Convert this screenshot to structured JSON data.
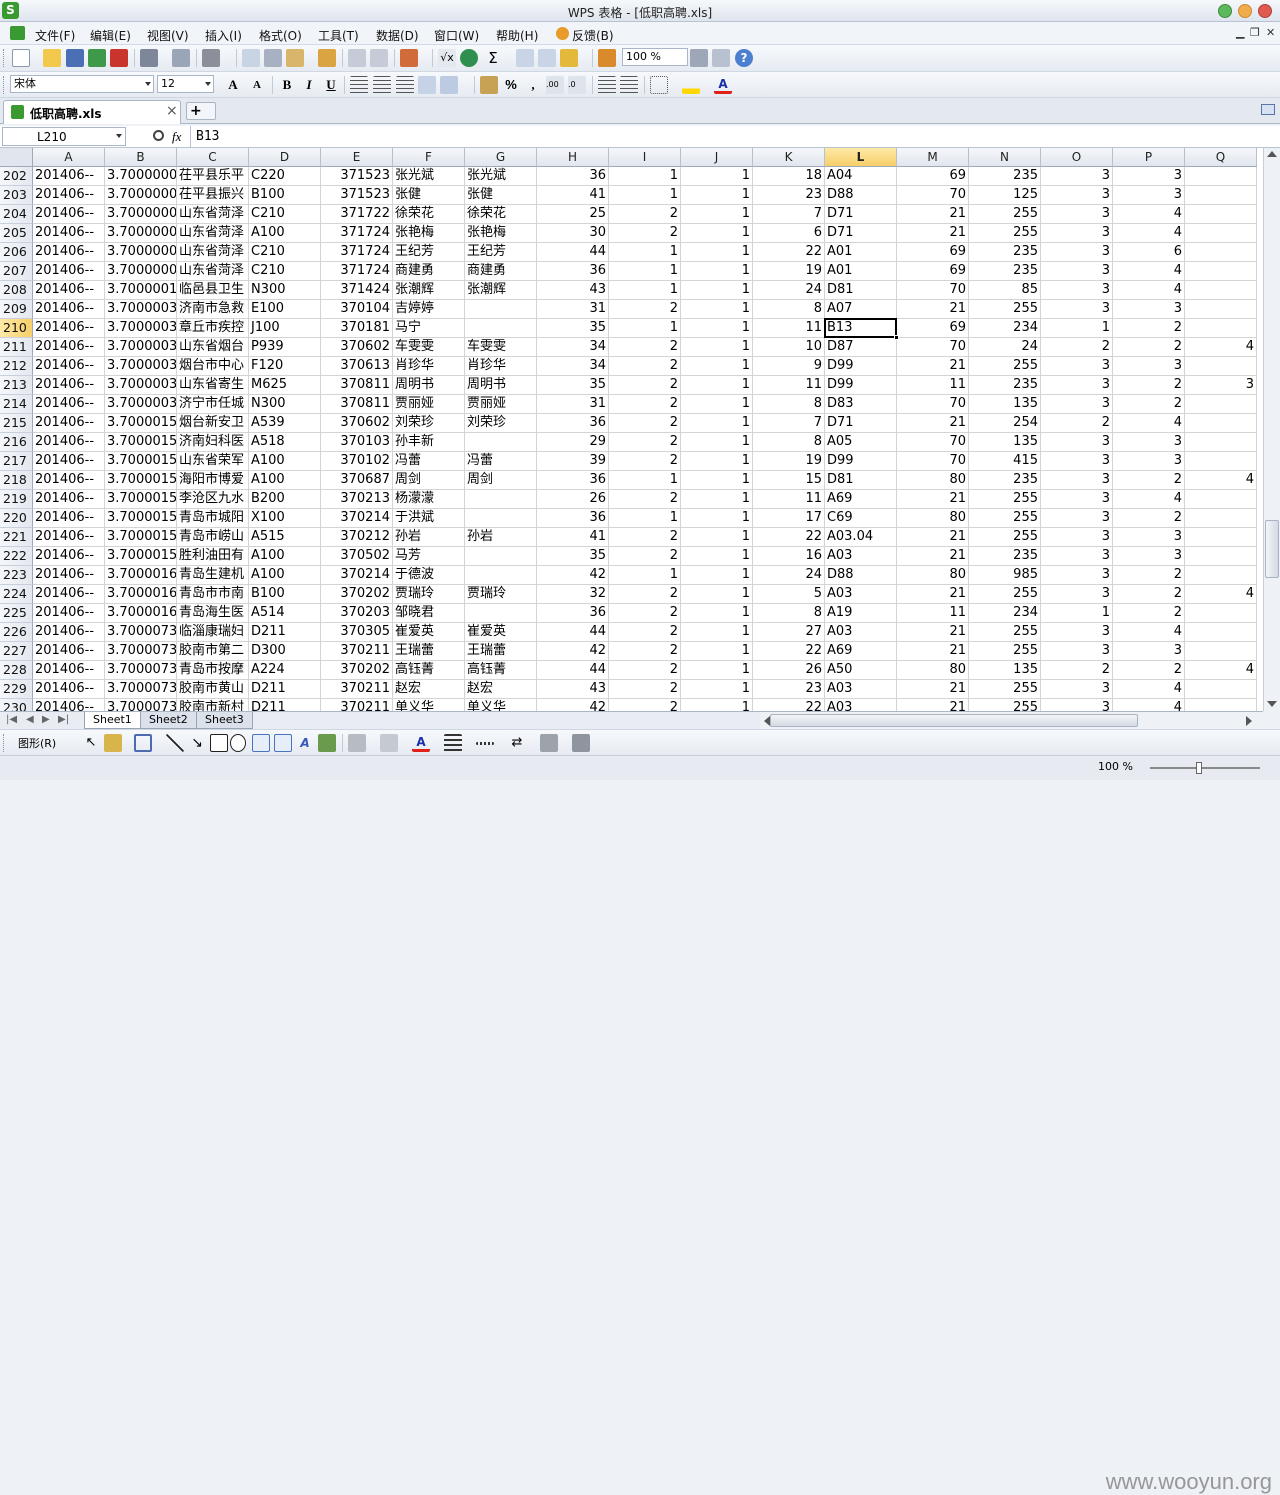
{
  "window": {
    "title": "WPS 表格 - [低职高聘.xls]"
  },
  "menu": [
    "文件(F)",
    "编辑(E)",
    "视图(V)",
    "插入(I)",
    "格式(O)",
    "工具(T)",
    "数据(D)",
    "窗口(W)",
    "帮助(H)",
    "反馈(B)"
  ],
  "toolbar": {
    "zoom": "100 %",
    "font_name": "宋体",
    "font_size": "12",
    "bold": "B",
    "italic": "I",
    "underline": "U",
    "percent": "%"
  },
  "doc_tab": {
    "label": "低职高聘.xls",
    "close": "×",
    "add": "+"
  },
  "formula_bar": {
    "name_box": "L210",
    "fx": "fx",
    "value": "B13"
  },
  "columns": [
    "A",
    "B",
    "C",
    "D",
    "E",
    "F",
    "G",
    "H",
    "I",
    "J",
    "K",
    "L",
    "M",
    "N",
    "O",
    "P",
    "Q"
  ],
  "active_column": "L",
  "active_row": "210",
  "rows": [
    {
      "n": "202",
      "A": "201406--",
      "B": "3.7000000",
      "C": "茌平县乐平",
      "D": "C220",
      "E": "371523",
      "F": "张光斌",
      "G": "张光斌",
      "H": "36",
      "I": "1",
      "J": "1",
      "K": "18",
      "L": "A04",
      "M": "69",
      "N": "235",
      "O": "3",
      "P": "3",
      "Q": ""
    },
    {
      "n": "203",
      "A": "201406--",
      "B": "3.7000000",
      "C": "茌平县振兴",
      "D": "B100",
      "E": "371523",
      "F": "张健",
      "G": "张健",
      "H": "41",
      "I": "1",
      "J": "1",
      "K": "23",
      "L": "D88",
      "M": "70",
      "N": "125",
      "O": "3",
      "P": "3",
      "Q": ""
    },
    {
      "n": "204",
      "A": "201406--",
      "B": "3.7000000",
      "C": "山东省菏泽",
      "D": "C210",
      "E": "371722",
      "F": "徐荣花",
      "G": "徐荣花",
      "H": "25",
      "I": "2",
      "J": "1",
      "K": "7",
      "L": "D71",
      "M": "21",
      "N": "255",
      "O": "3",
      "P": "4",
      "Q": ""
    },
    {
      "n": "205",
      "A": "201406--",
      "B": "3.7000000",
      "C": "山东省菏泽",
      "D": "A100",
      "E": "371724",
      "F": "张艳梅",
      "G": "张艳梅",
      "H": "30",
      "I": "2",
      "J": "1",
      "K": "6",
      "L": "D71",
      "M": "21",
      "N": "255",
      "O": "3",
      "P": "4",
      "Q": ""
    },
    {
      "n": "206",
      "A": "201406--",
      "B": "3.7000000",
      "C": "山东省菏泽",
      "D": "C210",
      "E": "371724",
      "F": "王纪芳",
      "G": "王纪芳",
      "H": "44",
      "I": "1",
      "J": "1",
      "K": "22",
      "L": "A01",
      "M": "69",
      "N": "235",
      "O": "3",
      "P": "6",
      "Q": ""
    },
    {
      "n": "207",
      "A": "201406--",
      "B": "3.7000000",
      "C": "山东省菏泽",
      "D": "C210",
      "E": "371724",
      "F": "商建勇",
      "G": "商建勇",
      "H": "36",
      "I": "1",
      "J": "1",
      "K": "19",
      "L": "A01",
      "M": "69",
      "N": "235",
      "O": "3",
      "P": "4",
      "Q": ""
    },
    {
      "n": "208",
      "A": "201406--",
      "B": "3.7000001",
      "C": "临邑县卫生",
      "D": "N300",
      "E": "371424",
      "F": "张潮辉",
      "G": "张潮辉",
      "H": "43",
      "I": "1",
      "J": "1",
      "K": "24",
      "L": "D81",
      "M": "70",
      "N": "85",
      "O": "3",
      "P": "4",
      "Q": ""
    },
    {
      "n": "209",
      "A": "201406--",
      "B": "3.7000003",
      "C": "济南市急救",
      "D": "E100",
      "E": "370104",
      "F": "吉婷婷",
      "G": "",
      "H": "31",
      "I": "2",
      "J": "1",
      "K": "8",
      "L": "A07",
      "M": "21",
      "N": "255",
      "O": "3",
      "P": "3",
      "Q": ""
    },
    {
      "n": "210",
      "A": "201406--",
      "B": "3.7000003",
      "C": "章丘市疾控",
      "D": "J100",
      "E": "370181",
      "F": "马宁",
      "G": "",
      "H": "35",
      "I": "1",
      "J": "1",
      "K": "11",
      "L": "B13",
      "M": "69",
      "N": "234",
      "O": "1",
      "P": "2",
      "Q": ""
    },
    {
      "n": "211",
      "A": "201406--",
      "B": "3.7000003",
      "C": "山东省烟台",
      "D": "P939",
      "E": "370602",
      "F": "车雯雯",
      "G": "车雯雯",
      "H": "34",
      "I": "2",
      "J": "1",
      "K": "10",
      "L": "D87",
      "M": "70",
      "N": "24",
      "O": "2",
      "P": "2",
      "Q": "4"
    },
    {
      "n": "212",
      "A": "201406--",
      "B": "3.7000003",
      "C": "烟台市中心",
      "D": "F120",
      "E": "370613",
      "F": "肖珍华",
      "G": "肖珍华",
      "H": "34",
      "I": "2",
      "J": "1",
      "K": "9",
      "L": "D99",
      "M": "21",
      "N": "255",
      "O": "3",
      "P": "3",
      "Q": ""
    },
    {
      "n": "213",
      "A": "201406--",
      "B": "3.7000003",
      "C": "山东省寄生",
      "D": "M625",
      "E": "370811",
      "F": "周明书",
      "G": "周明书",
      "H": "35",
      "I": "2",
      "J": "1",
      "K": "11",
      "L": "D99",
      "M": "11",
      "N": "235",
      "O": "3",
      "P": "2",
      "Q": "3"
    },
    {
      "n": "214",
      "A": "201406--",
      "B": "3.7000003",
      "C": "济宁市任城",
      "D": "N300",
      "E": "370811",
      "F": "贾丽娅",
      "G": "贾丽娅",
      "H": "31",
      "I": "2",
      "J": "1",
      "K": "8",
      "L": "D83",
      "M": "70",
      "N": "135",
      "O": "3",
      "P": "2",
      "Q": ""
    },
    {
      "n": "215",
      "A": "201406--",
      "B": "3.7000015",
      "C": "烟台新安卫",
      "D": "A539",
      "E": "370602",
      "F": "刘荣珍",
      "G": "刘荣珍",
      "H": "36",
      "I": "2",
      "J": "1",
      "K": "7",
      "L": "D71",
      "M": "21",
      "N": "254",
      "O": "2",
      "P": "4",
      "Q": ""
    },
    {
      "n": "216",
      "A": "201406--",
      "B": "3.7000015",
      "C": "济南妇科医",
      "D": "A518",
      "E": "370103",
      "F": "孙丰新",
      "G": "",
      "H": "29",
      "I": "2",
      "J": "1",
      "K": "8",
      "L": "A05",
      "M": "70",
      "N": "135",
      "O": "3",
      "P": "3",
      "Q": ""
    },
    {
      "n": "217",
      "A": "201406--",
      "B": "3.7000015",
      "C": "山东省荣军",
      "D": "A100",
      "E": "370102",
      "F": "冯蕾",
      "G": "冯蕾",
      "H": "39",
      "I": "2",
      "J": "1",
      "K": "19",
      "L": "D99",
      "M": "70",
      "N": "415",
      "O": "3",
      "P": "3",
      "Q": ""
    },
    {
      "n": "218",
      "A": "201406--",
      "B": "3.7000015",
      "C": "海阳市博爱",
      "D": "A100",
      "E": "370687",
      "F": "周剑",
      "G": "周剑",
      "H": "36",
      "I": "1",
      "J": "1",
      "K": "15",
      "L": "D81",
      "M": "80",
      "N": "235",
      "O": "3",
      "P": "2",
      "Q": "4"
    },
    {
      "n": "219",
      "A": "201406--",
      "B": "3.7000015",
      "C": "李沧区九水",
      "D": "B200",
      "E": "370213",
      "F": "杨濛濛",
      "G": "",
      "H": "26",
      "I": "2",
      "J": "1",
      "K": "11",
      "L": "A69",
      "M": "21",
      "N": "255",
      "O": "3",
      "P": "4",
      "Q": ""
    },
    {
      "n": "220",
      "A": "201406--",
      "B": "3.7000015",
      "C": "青岛市城阳",
      "D": "X100",
      "E": "370214",
      "F": "于洪斌",
      "G": "",
      "H": "36",
      "I": "1",
      "J": "1",
      "K": "17",
      "L": "C69",
      "M": "80",
      "N": "255",
      "O": "3",
      "P": "2",
      "Q": ""
    },
    {
      "n": "221",
      "A": "201406--",
      "B": "3.7000015",
      "C": "青岛市崂山",
      "D": "A515",
      "E": "370212",
      "F": "孙岩",
      "G": "孙岩",
      "H": "41",
      "I": "2",
      "J": "1",
      "K": "22",
      "L": "A03.04",
      "M": "21",
      "N": "255",
      "O": "3",
      "P": "3",
      "Q": ""
    },
    {
      "n": "222",
      "A": "201406--",
      "B": "3.7000015",
      "C": "胜利油田有",
      "D": "A100",
      "E": "370502",
      "F": "马芳",
      "G": "",
      "H": "35",
      "I": "2",
      "J": "1",
      "K": "16",
      "L": "A03",
      "M": "21",
      "N": "235",
      "O": "3",
      "P": "3",
      "Q": ""
    },
    {
      "n": "223",
      "A": "201406--",
      "B": "3.7000016",
      "C": "青岛生建机",
      "D": "A100",
      "E": "370214",
      "F": "于德波",
      "G": "",
      "H": "42",
      "I": "1",
      "J": "1",
      "K": "24",
      "L": "D88",
      "M": "80",
      "N": "985",
      "O": "3",
      "P": "2",
      "Q": ""
    },
    {
      "n": "224",
      "A": "201406--",
      "B": "3.7000016",
      "C": "青岛市市南",
      "D": "B100",
      "E": "370202",
      "F": "贾瑞玲",
      "G": "贾瑞玲",
      "H": "32",
      "I": "2",
      "J": "1",
      "K": "5",
      "L": "A03",
      "M": "21",
      "N": "255",
      "O": "3",
      "P": "2",
      "Q": "4"
    },
    {
      "n": "225",
      "A": "201406--",
      "B": "3.7000016",
      "C": "青岛海生医",
      "D": "A514",
      "E": "370203",
      "F": "邹晓君",
      "G": "",
      "H": "36",
      "I": "2",
      "J": "1",
      "K": "8",
      "L": "A19",
      "M": "11",
      "N": "234",
      "O": "1",
      "P": "2",
      "Q": ""
    },
    {
      "n": "226",
      "A": "201406--",
      "B": "3.7000073",
      "C": "临淄康瑞妇",
      "D": "D211",
      "E": "370305",
      "F": "崔爱英",
      "G": "崔爱英",
      "H": "44",
      "I": "2",
      "J": "1",
      "K": "27",
      "L": "A03",
      "M": "21",
      "N": "255",
      "O": "3",
      "P": "4",
      "Q": ""
    },
    {
      "n": "227",
      "A": "201406--",
      "B": "3.7000073",
      "C": "胶南市第二",
      "D": "D300",
      "E": "370211",
      "F": "王瑞蕾",
      "G": "王瑞蕾",
      "H": "42",
      "I": "2",
      "J": "1",
      "K": "22",
      "L": "A69",
      "M": "21",
      "N": "255",
      "O": "3",
      "P": "3",
      "Q": ""
    },
    {
      "n": "228",
      "A": "201406--",
      "B": "3.7000073",
      "C": "青岛市按摩",
      "D": "A224",
      "E": "370202",
      "F": "高钰菁",
      "G": "高钰菁",
      "H": "44",
      "I": "2",
      "J": "1",
      "K": "26",
      "L": "A50",
      "M": "80",
      "N": "135",
      "O": "2",
      "P": "2",
      "Q": "4"
    },
    {
      "n": "229",
      "A": "201406--",
      "B": "3.7000073",
      "C": "胶南市黄山",
      "D": "D211",
      "E": "370211",
      "F": "赵宏",
      "G": "赵宏",
      "H": "43",
      "I": "2",
      "J": "1",
      "K": "23",
      "L": "A03",
      "M": "21",
      "N": "255",
      "O": "3",
      "P": "4",
      "Q": ""
    },
    {
      "n": "230",
      "A": "201406--",
      "B": "3.7000073",
      "C": "胶南市新村",
      "D": "D211",
      "E": "370211",
      "F": "单义华",
      "G": "单义华",
      "H": "42",
      "I": "2",
      "J": "1",
      "K": "22",
      "L": "A03",
      "M": "21",
      "N": "255",
      "O": "3",
      "P": "4",
      "Q": ""
    }
  ],
  "sheets": [
    "Sheet1",
    "Sheet2",
    "Sheet3"
  ],
  "active_sheet": "Sheet1",
  "drawbar": {
    "shapes_label": "图形(R)"
  },
  "status": {
    "zoom": "100 %"
  },
  "watermark": "www.wooyun.org",
  "colors": {
    "accent": "#3a9a32",
    "selection": "#f7cf6a"
  }
}
